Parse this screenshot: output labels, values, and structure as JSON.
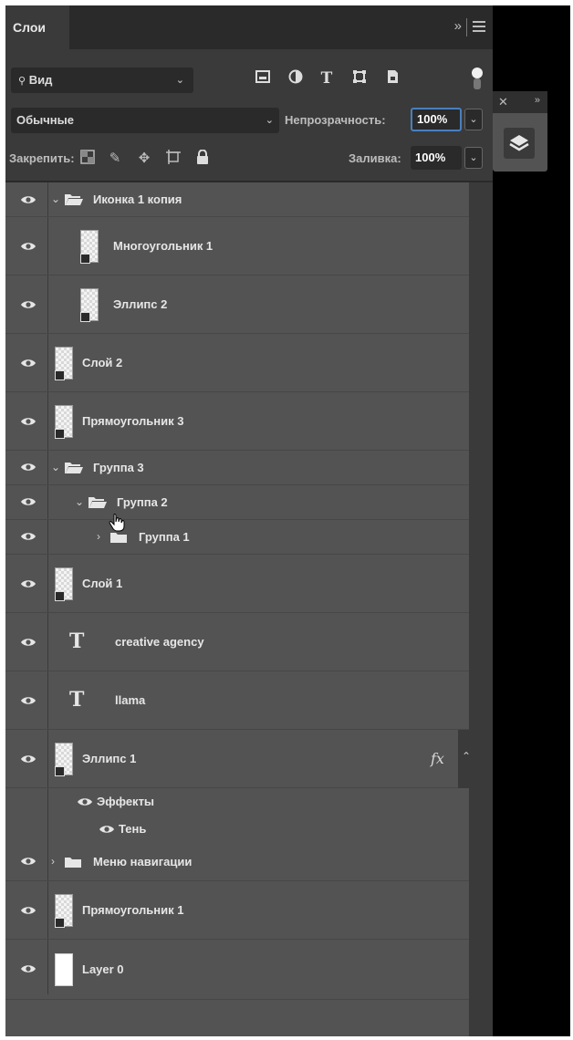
{
  "panel": {
    "tab_label": "Слои",
    "filter": {
      "label": "Вид",
      "search_glyph": "🔍"
    },
    "blend_mode": "Обычные",
    "opacity_label": "Непрозрачность:",
    "opacity_value": "100%",
    "lock_label": "Закрепить:",
    "fill_label": "Заливка:",
    "fill_value": "100%"
  },
  "layers": [
    {
      "name": "Иконка 1 копия",
      "kind": "group",
      "expanded": true
    },
    {
      "name": "Многоугольник 1",
      "kind": "shape"
    },
    {
      "name": "Эллипс 2",
      "kind": "shape"
    },
    {
      "name": "Слой 2",
      "kind": "smart"
    },
    {
      "name": "Прямоугольник 3",
      "kind": "shape"
    },
    {
      "name": "Группа 3",
      "kind": "group",
      "expanded": true
    },
    {
      "name": "Группа 2",
      "kind": "group",
      "expanded": true
    },
    {
      "name": "Группа 1",
      "kind": "group",
      "expanded": false
    },
    {
      "name": "Слой 1",
      "kind": "smart"
    },
    {
      "name": "creative agency",
      "kind": "text"
    },
    {
      "name": "llama",
      "kind": "text"
    },
    {
      "name": "Эллипс 1",
      "kind": "shape",
      "fx": "fx"
    },
    {
      "name": "Эффекты",
      "kind": "effects"
    },
    {
      "name": "Тень",
      "kind": "effect"
    },
    {
      "name": "Меню навигации",
      "kind": "group",
      "expanded": false
    },
    {
      "name": "Прямоугольник 1",
      "kind": "shape"
    },
    {
      "name": "Layer 0",
      "kind": "raster"
    }
  ],
  "colors": {
    "panel": "#535353",
    "dark": "#2a2a2a",
    "focus": "#4a7fbf"
  }
}
